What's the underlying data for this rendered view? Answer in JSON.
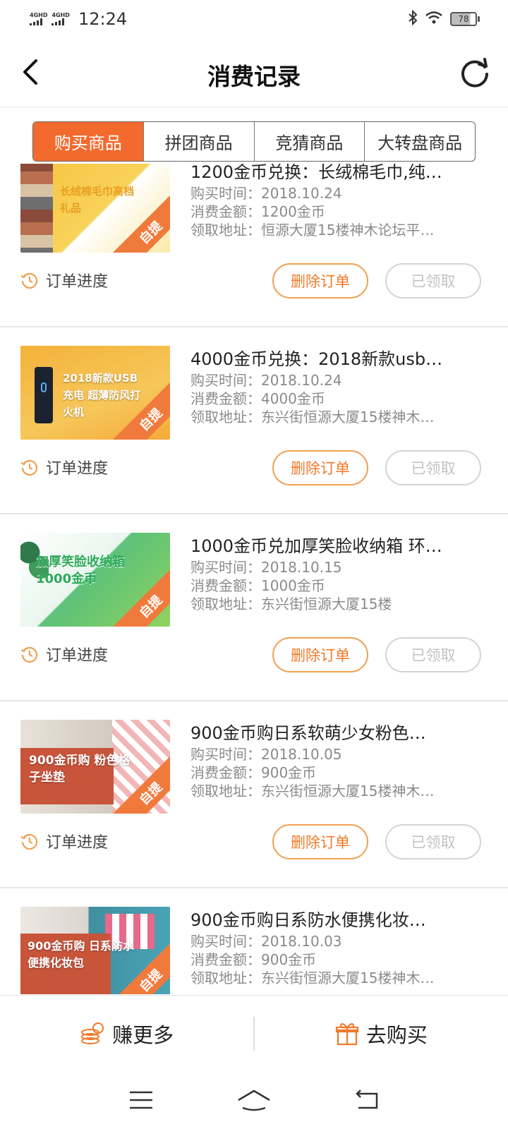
{
  "status_bar": {
    "sim1": "4GHD",
    "sim2": "4GHD",
    "time": "12:24",
    "battery": "78"
  },
  "header": {
    "title": "消费记录"
  },
  "tabs": [
    {
      "label": "购买商品",
      "active": true
    },
    {
      "label": "拼团商品",
      "active": false
    },
    {
      "label": "竞猜商品",
      "active": false
    },
    {
      "label": "大转盘商品",
      "active": false
    }
  ],
  "labels": {
    "time_prefix": "购买时间：",
    "amount_prefix": "消费金额：",
    "address_prefix": "领取地址：",
    "progress": "订单进度",
    "delete": "删除订单",
    "received": "已领取",
    "ribbon": "自提"
  },
  "orders": [
    {
      "name": "1200金币兑换：长绒棉毛巾,纯…",
      "time": "2018.10.24",
      "amount": "1200金币",
      "address": "恒源大厦15楼神木论坛平…",
      "thumb_text": "长绒棉毛巾高档礼品"
    },
    {
      "name": "4000金币兑换：2018新款usb…",
      "time": "2018.10.24",
      "amount": "4000金币",
      "address": "东兴街恒源大厦15楼神木…",
      "thumb_text": "2018新款USB充电 超薄防风打火机"
    },
    {
      "name": "1000金币兑加厚笑脸收纳箱 环…",
      "time": "2018.10.15",
      "amount": "1000金币",
      "address": "东兴街恒源大厦15楼",
      "thumb_text": "加厚笑脸收纳箱 1000金币"
    },
    {
      "name": "900金币购日系软萌少女粉色…",
      "time": "2018.10.05",
      "amount": "900金币",
      "address": "东兴街恒源大厦15楼神木…",
      "thumb_text": "900金币购 粉色格子坐垫"
    },
    {
      "name": "900金币购日系防水便携化妆…",
      "time": "2018.10.03",
      "amount": "900金币",
      "address": "东兴街恒源大厦15楼神木…",
      "thumb_text": "900金币购 日系防水便携化妆包"
    }
  ],
  "bottom_bar": {
    "earn": "赚更多",
    "buy": "去购买"
  },
  "colors": {
    "accent": "#f26a2e",
    "button_border": "#f0a052",
    "disabled": "#c2c2c2"
  }
}
